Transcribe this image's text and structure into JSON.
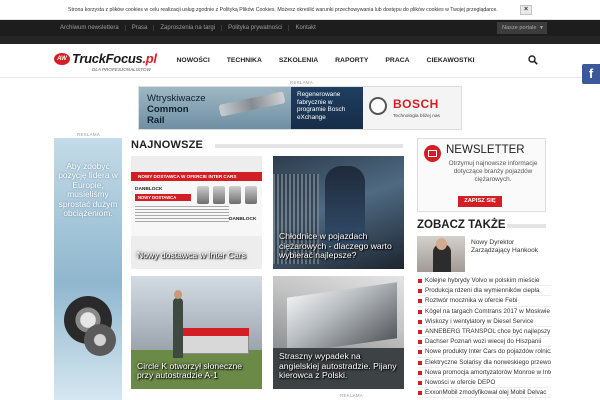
{
  "cookie": {
    "text": "Strona korzysta z plików cookies w celu realizacji usług zgodnie z Polityką Plików Cookies. Możesz określić warunki przechowywania lub dostępu do plików cookies w Twojej przeglądarce.",
    "close_label": "×"
  },
  "topbar": {
    "links": [
      "Archiwum newslettera",
      "Prasa",
      "Zaproszenia na targi",
      "Polityka prywatności",
      "Kontakt"
    ],
    "portals_label": "Nasze portale",
    "portals_arrow": "▼"
  },
  "logo": {
    "mark": "AW",
    "name_main": "TruckFocus",
    "name_tld": ".pl",
    "tagline": "DLA PROFESJONALISTÓW"
  },
  "nav": {
    "items": [
      "NOWOŚCI",
      "TECHNIKA",
      "SZKOLENIA",
      "RAPORTY",
      "PRACA",
      "CIEKAWOSTKI"
    ]
  },
  "facebook": {
    "label": "f"
  },
  "ads": {
    "label": "REKLAMA",
    "banner": {
      "left_line1": "Wtryskiwacze",
      "left_line2": "Common",
      "left_line3": "Rail",
      "mid_text": "Regenerowane fabrycznie w programie Bosch eXchange",
      "brand": "BOSCH",
      "slogan": "Technologia bliżej nas"
    },
    "sky_text": "Aby zdobyć pozycję lidera w Europie, musieliśmy sprostać dużym obciążeniom."
  },
  "latest": {
    "title": "NAJNOWSZE",
    "tiles": [
      {
        "title": "Nowy dostawca w Inter Cars",
        "band1": "NOWY DOSTAWCA W OFERCIE INTER CARS",
        "brand": "DANBLOCK",
        "band2": "NOWY DOSTAWCA"
      },
      {
        "title": "Chłodnice w pojazdach ciężarowych - dlaczego warto wybierać najlepsze?"
      },
      {
        "title": "Circle K otworzył słoneczne przy autostradzie A-1"
      },
      {
        "title": "Straszny wypadek na angielskiej autostradzie. Pijany kierowca z Polski."
      }
    ]
  },
  "newsletter": {
    "title": "NEWSLETTER",
    "text": "Otrzymuj najnowsze informacje dotyczące branży pojazdów ciężarowych.",
    "button": "ZAPISZ SIĘ"
  },
  "see_also": {
    "title": "ZOBACZ TAKŻE",
    "headline": "Nowy Dyrektor Zarządzający Hankook",
    "items": [
      "Kolejne hybrydy Volvo w polskim mieście",
      "Produkcja rdzeni dla wymienników ciepła",
      "Roztwór mocznika w ofercie Febi",
      "Kögel na targach Comtrans 2017 w Moskwie",
      "Wiskozy i wentylatory w Diesel Service",
      "ANNEBERG TRANSPOL chce być najlepszy",
      "Dachser Poznań wozi wiecej do Hiszpanii",
      "Nowe produkty Inter Cars do pojazdów rolniczych",
      "Elektryczne Solarisy dla norweskiego przewoźnika",
      "Nowa promocja amortyzatorów Monroe w Inter Cars",
      "Nowości w ofercie DEPO",
      "ExxonMobil zmodyfikował olej Mobil Delvac"
    ]
  }
}
